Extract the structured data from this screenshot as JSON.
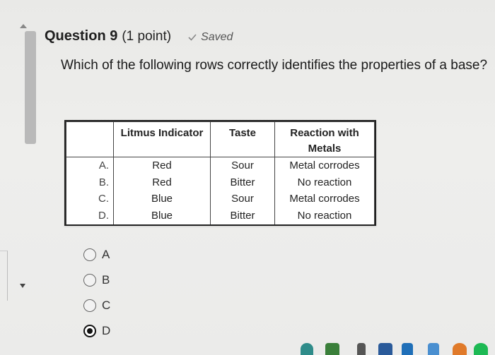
{
  "question": {
    "title": "Question 9",
    "points": "(1 point)",
    "status": "Saved",
    "text": "Which of the following rows correctly identifies the properties of a base?"
  },
  "table": {
    "headers": [
      "",
      "Litmus Indicator",
      "Taste",
      "Reaction with Metals"
    ],
    "rows": [
      [
        "A.",
        "Red",
        "Sour",
        "Metal corrodes"
      ],
      [
        "B.",
        "Red",
        "Bitter",
        "No reaction"
      ],
      [
        "C.",
        "Blue",
        "Sour",
        "Metal corrodes"
      ],
      [
        "D.",
        "Blue",
        "Bitter",
        "No reaction"
      ]
    ]
  },
  "options": [
    {
      "label": "A",
      "selected": false
    },
    {
      "label": "B",
      "selected": false
    },
    {
      "label": "C",
      "selected": false
    },
    {
      "label": "D",
      "selected": true
    }
  ],
  "icons": {
    "saved": "check-icon",
    "scroll_up": "arrow-up-icon",
    "scroll_down": "arrow-down-icon"
  },
  "colors": {
    "background": "#ececea",
    "table_border": "#222222",
    "scroll_thumb": "#b9b9b9"
  }
}
